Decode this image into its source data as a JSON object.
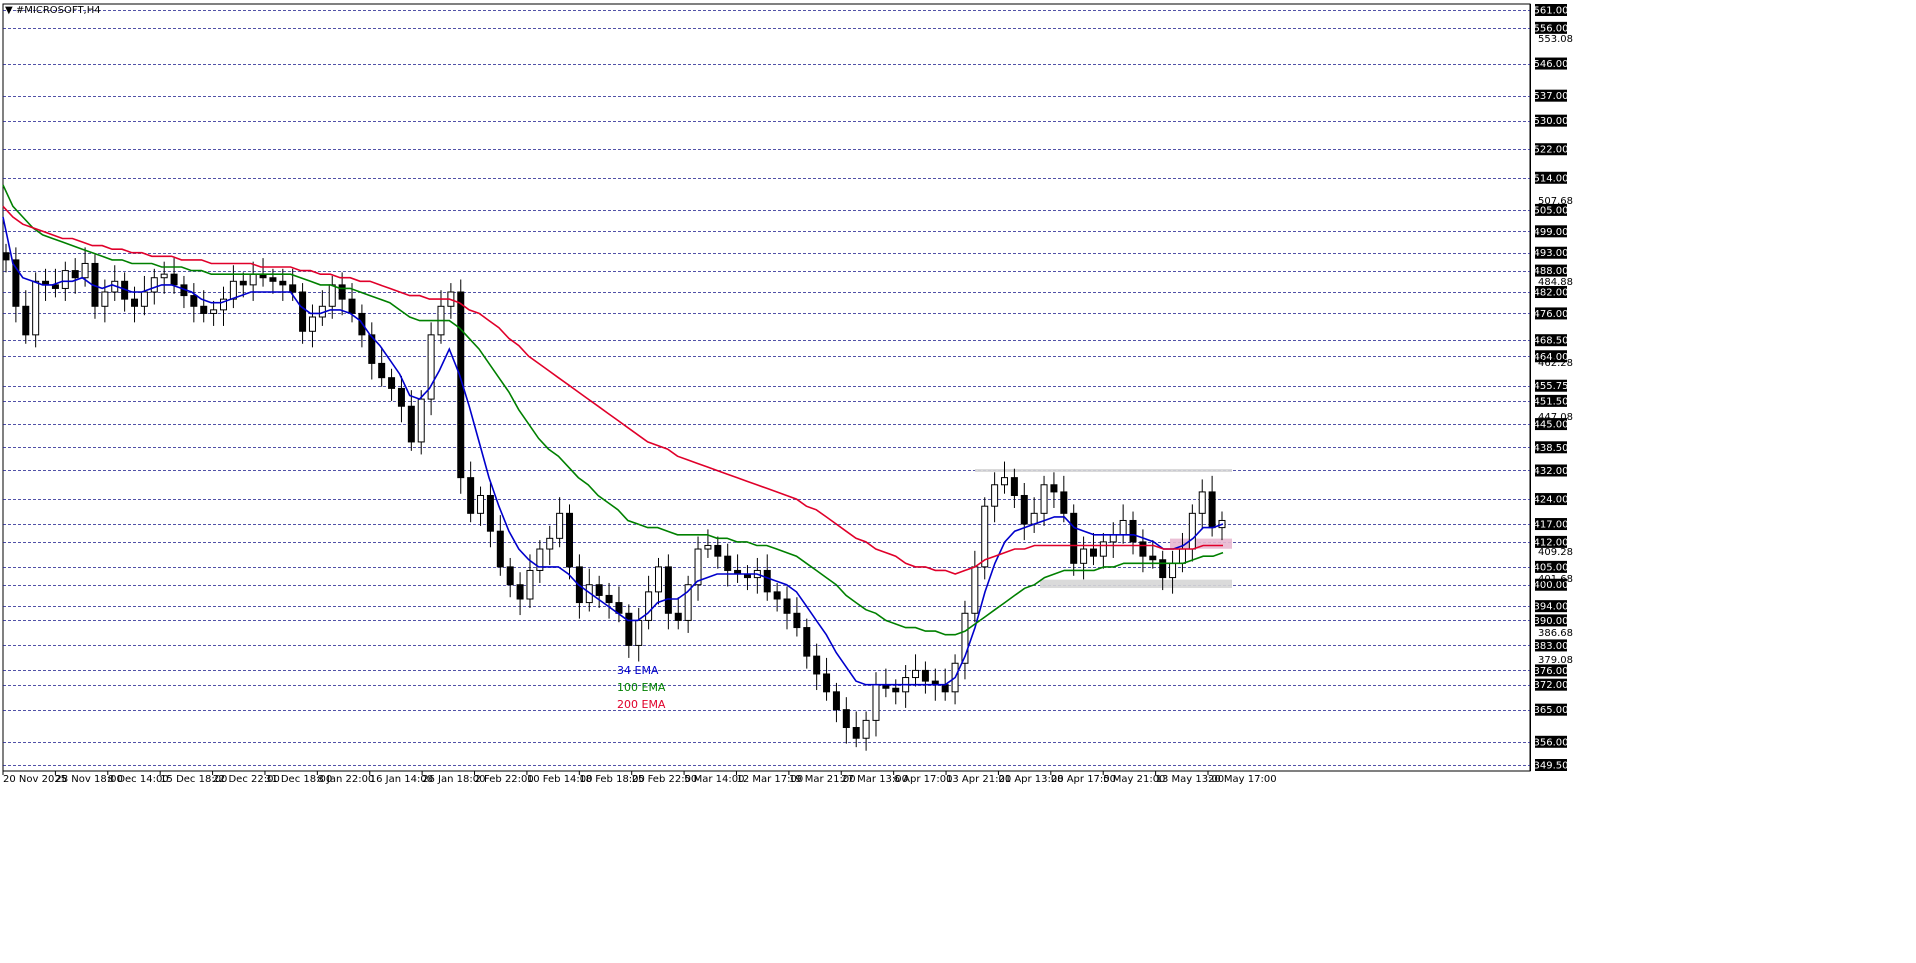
{
  "window": {
    "symbol_title": "#MICROSOFT,H4",
    "title_arrow": "▼"
  },
  "chart_data": {
    "type": "candlestick",
    "symbol": "#MICROSOFT",
    "timeframe": "H4",
    "ylim": [
      349.5,
      561.0
    ],
    "price_levels": [
      561.0,
      556.0,
      546.0,
      537.0,
      530.0,
      522.0,
      514.0,
      505.0,
      499.0,
      493.0,
      488.0,
      482.0,
      476.0,
      468.5,
      464.0,
      455.75,
      451.5,
      445.0,
      438.5,
      432.0,
      424.0,
      417.0,
      412.0,
      405.0,
      400.0,
      394.0,
      390.0,
      383.0,
      376.0,
      372.0,
      365.0,
      356.0,
      349.5
    ],
    "scale_ticks": [
      "553.08",
      "507.68",
      "484.88",
      "462.28",
      "447.08",
      "401.68",
      "386.68",
      "379.08",
      "409.28"
    ],
    "time_labels": [
      "20 Nov 2025",
      "28 Nov 18:00",
      "8 Dec 14:00",
      "15 Dec 18:00",
      "22 Dec 22:00",
      "31 Dec 18:00",
      "8 Jan 22:00",
      "16 Jan 14:00",
      "26 Jan 18:00",
      "2 Feb 22:00",
      "10 Feb 14:00",
      "18 Feb 18:00",
      "25 Feb 22:00",
      "5 Mar 14:00",
      "12 Mar 17:00",
      "19 Mar 21:00",
      "27 Mar 13:00",
      "6 Apr 17:00",
      "13 Apr 21:00",
      "21 Apr 13:00",
      "28 Apr 17:00",
      "5 May 21:00",
      "13 May 13:00",
      "20 May 17:00"
    ],
    "candles_close": [
      491,
      478,
      470,
      485,
      484,
      483,
      488,
      486,
      490,
      478,
      482,
      485,
      480,
      478,
      482,
      486,
      487,
      484,
      481,
      478,
      476,
      477,
      480,
      485,
      484,
      487,
      486,
      485,
      484,
      482,
      471,
      475,
      478,
      484,
      480,
      476,
      470,
      462,
      458,
      455,
      450,
      440,
      452,
      470,
      478,
      482,
      430,
      420,
      425,
      415,
      405,
      400,
      396,
      404,
      410,
      413,
      420,
      405,
      395,
      400,
      397,
      395,
      392,
      383,
      390,
      398,
      405,
      392,
      390,
      400,
      410,
      411,
      408,
      404,
      403,
      402,
      404,
      398,
      396,
      392,
      388,
      380,
      375,
      370,
      365,
      360,
      357,
      362,
      372,
      371,
      370,
      374,
      376,
      373,
      372,
      370,
      378,
      392,
      405,
      422,
      428,
      430,
      425,
      417,
      420,
      428,
      426,
      420,
      406,
      410,
      408,
      412,
      414,
      418,
      412,
      408,
      407,
      402,
      406,
      410,
      420,
      426,
      416,
      418
    ],
    "series": [
      {
        "name": "34 EMA",
        "color": "#0000cc",
        "values": [
          503,
          490,
          486,
          485,
          484,
          484,
          485,
          485,
          486,
          484,
          483,
          484,
          483,
          482,
          482,
          483,
          484,
          484,
          483,
          482,
          480,
          479,
          479,
          480,
          481,
          482,
          482,
          482,
          482,
          482,
          478,
          476,
          476,
          477,
          477,
          476,
          474,
          470,
          467,
          463,
          459,
          453,
          452,
          455,
          460,
          466,
          459,
          450,
          440,
          430,
          422,
          415,
          410,
          407,
          405,
          405,
          405,
          403,
          400,
          398,
          396,
          394,
          392,
          390,
          390,
          392,
          395,
          396,
          396,
          398,
          401,
          402,
          403,
          403,
          403,
          403,
          403,
          402,
          401,
          400,
          398,
          394,
          390,
          386,
          381,
          377,
          373,
          372,
          372,
          372,
          372,
          372,
          372,
          372,
          372,
          372,
          374,
          380,
          388,
          398,
          406,
          412,
          415,
          416,
          417,
          418,
          419,
          419,
          416,
          415,
          414,
          414,
          414,
          414,
          414,
          413,
          412,
          410,
          410,
          411,
          413,
          416,
          416,
          417
        ]
      },
      {
        "name": "100 EMA",
        "color": "#008000",
        "values": [
          512,
          506,
          503,
          500,
          498,
          497,
          496,
          495,
          494,
          493,
          492,
          491,
          491,
          490,
          490,
          490,
          489,
          489,
          489,
          488,
          488,
          487,
          487,
          487,
          487,
          487,
          487,
          487,
          487,
          487,
          486,
          485,
          484,
          484,
          483,
          483,
          482,
          481,
          480,
          479,
          477,
          475,
          474,
          474,
          474,
          474,
          472,
          469,
          466,
          462,
          458,
          454,
          449,
          445,
          441,
          438,
          436,
          433,
          430,
          428,
          425,
          423,
          421,
          418,
          417,
          416,
          416,
          415,
          414,
          414,
          414,
          414,
          413,
          413,
          412,
          412,
          411,
          411,
          410,
          409,
          408,
          406,
          404,
          402,
          400,
          397,
          395,
          393,
          392,
          390,
          389,
          388,
          388,
          387,
          387,
          386,
          386,
          387,
          389,
          391,
          393,
          395,
          397,
          399,
          400,
          402,
          403,
          404,
          404,
          404,
          404,
          405,
          405,
          406,
          406,
          406,
          406,
          406,
          406,
          406,
          407,
          408,
          408,
          409
        ]
      },
      {
        "name": "200 EMA",
        "color": "#e0002a",
        "values": [
          506,
          503,
          501,
          500,
          499,
          498,
          497,
          497,
          496,
          495,
          495,
          494,
          494,
          493,
          493,
          492,
          492,
          492,
          491,
          491,
          491,
          490,
          490,
          490,
          490,
          490,
          489,
          489,
          489,
          489,
          488,
          488,
          487,
          487,
          486,
          486,
          485,
          485,
          484,
          483,
          482,
          481,
          481,
          480,
          480,
          480,
          479,
          477,
          476,
          474,
          472,
          469,
          467,
          464,
          462,
          460,
          458,
          456,
          454,
          452,
          450,
          448,
          446,
          444,
          442,
          440,
          439,
          438,
          436,
          435,
          434,
          433,
          432,
          431,
          430,
          429,
          428,
          427,
          426,
          425,
          424,
          422,
          421,
          419,
          417,
          415,
          413,
          412,
          410,
          409,
          408,
          406,
          405,
          405,
          404,
          404,
          403,
          404,
          405,
          407,
          408,
          409,
          410,
          410,
          411,
          411,
          411,
          411,
          411,
          411,
          411,
          411,
          411,
          411,
          411,
          411,
          411,
          410,
          410,
          410,
          410,
          411,
          411,
          411
        ]
      }
    ],
    "zones": [
      {
        "name": "resistance",
        "from": 432.0,
        "to": 432.0
      },
      {
        "name": "pivot",
        "from": 410.5,
        "to": 412.5
      },
      {
        "name": "support",
        "from": 399.5,
        "to": 401.0
      }
    ],
    "legend": [
      "34 EMA",
      "100 EMA",
      "200 EMA"
    ],
    "colors": {
      "up": "#000000",
      "down": "#000000",
      "grid": "#1a1a8c",
      "label_bg": "#000000",
      "label_fg": "#ffffff"
    }
  }
}
